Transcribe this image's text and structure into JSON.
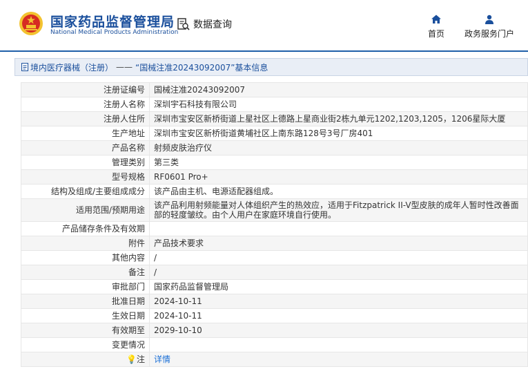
{
  "header": {
    "brand_cn": "国家药品监督管理局",
    "brand_en": "National Medical Products Administration",
    "query_tab": "数据查询",
    "nav": [
      {
        "label": "首页",
        "icon": "home-icon"
      },
      {
        "label": "政务服务门户",
        "icon": "user-icon"
      }
    ]
  },
  "breadcrumb": {
    "category": "境内医疗器械（注册）",
    "separator": "——",
    "title": "“国械注准20243092007”基本信息"
  },
  "colors": {
    "brand_blue": "#1a4f9c",
    "link_blue": "#1a6fd6",
    "emblem_red": "#d62b22",
    "emblem_gold": "#f3c330"
  },
  "rows": [
    {
      "label": "注册证编号",
      "value": "国械注准20243092007"
    },
    {
      "label": "注册人名称",
      "value": "深圳宇石科技有限公司"
    },
    {
      "label": "注册人住所",
      "value": "深圳市宝安区新桥街道上星社区上德路上星商业街2栋九单元1202,1203,1205，1206星际大厦"
    },
    {
      "label": "生产地址",
      "value": "深圳市宝安区新桥街道黄埔社区上南东路128号3号厂房401"
    },
    {
      "label": "产品名称",
      "value": "射频皮肤治疗仪"
    },
    {
      "label": "管理类别",
      "value": "第三类"
    },
    {
      "label": "型号规格",
      "value": "RF0601 Pro+"
    },
    {
      "label": "结构及组成/主要组成成分",
      "value": "该产品由主机、电源适配器组成。"
    },
    {
      "label": "适用范围/预期用途",
      "value": "该产品利用射频能量对人体组织产生的热效应，适用于Fitzpatrick II-V型皮肤的成年人暂时性改善面部的轻度皱纹。由个人用户在家庭环境自行使用。"
    },
    {
      "label": "产品储存条件及有效期",
      "value": ""
    },
    {
      "label": "附件",
      "value": "产品技术要求"
    },
    {
      "label": "其他内容",
      "value": "/"
    },
    {
      "label": "备注",
      "value": "/"
    },
    {
      "label": "审批部门",
      "value": "国家药品监督管理局"
    },
    {
      "label": "批准日期",
      "value": "2024-10-11"
    },
    {
      "label": "生效日期",
      "value": "2024-10-11"
    },
    {
      "label": "有效期至",
      "value": "2029-10-10"
    },
    {
      "label": "变更情况",
      "value": ""
    },
    {
      "label": "注",
      "value": "详情"
    }
  ]
}
